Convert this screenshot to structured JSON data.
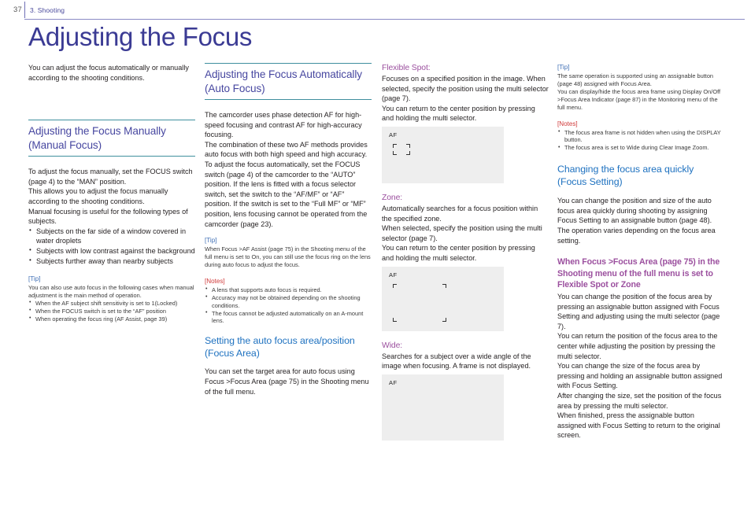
{
  "header": {
    "page_number": "37",
    "section": "3. Shooting"
  },
  "title": "Adjusting the Focus",
  "col1": {
    "intro": "You can adjust the focus automatically or manually according to the shooting conditions.",
    "heading": "Adjusting the Focus Manually (Manual Focus)",
    "para1": "To adjust the focus manually, set the FOCUS switch (page 4) to the “MAN” position.\nThis allows you to adjust the focus manually according to the shooting conditions.\nManual focusing is useful for the following types of subjects.",
    "bullets": [
      "Subjects on the far side of a window covered in water droplets",
      "Subjects with low contrast against the background",
      "Subjects further away than nearby subjects"
    ],
    "tip_title": "[Tip]",
    "tip_text": "You can also use auto focus in the following cases when manual adjustment is the main method of operation.",
    "tip_bullets": [
      "When the AF subject shift sensitivity is set to 1(Locked)",
      "When the FOCUS switch is set to the “AF” position",
      "When operating the focus ring (AF Assist, page 39)"
    ]
  },
  "col2": {
    "heading": "Adjusting the Focus Automatically (Auto Focus)",
    "para1": "The camcorder uses phase detection AF for high-speed focusing and contrast AF for high-accuracy focusing.\nThe combination of these two AF methods provides auto focus with both high speed and high accuracy.\nTo adjust the focus automatically, set the FOCUS switch (page 4) of the camcorder to the “AUTO” position. If the lens is fitted with a focus selector switch, set the switch to the “AF/MF” or “AF” position. If the switch is set to the “Full MF” or “MF” position, lens focusing cannot be operated from the camcorder (page 23).",
    "tip_title": "[Tip]",
    "tip_text": "When Focus >AF Assist (page 75) in the Shooting menu of the full menu is set to On, you can still use the focus ring on the lens during auto focus to adjust the focus.",
    "notes_title": "[Notes]",
    "notes_bullets": [
      "A lens that supports auto focus is required.",
      "Accuracy may not be obtained depending on the shooting conditions.",
      "The focus cannot be adjusted automatically on an A-mount lens."
    ],
    "subheading": "Setting the auto focus area/position (Focus Area)",
    "para2": "You can set the target area for auto focus using Focus >Focus Area (page 75) in the Shooting menu of the full menu."
  },
  "col3": {
    "flexible_spot_label": "Flexible Spot:",
    "flexible_spot_text": "Focuses on a specified position in the image. When selected, specify the position using the multi selector (page 7).\nYou can return to the center position by pressing and holding the multi selector.",
    "flexible_spot_screen_label": "AF",
    "zone_label": "Zone:",
    "zone_text": "Automatically searches for a focus position within the specified zone.\nWhen selected, specify the position using the multi selector (page 7).\nYou can return to the center position by pressing and holding the multi selector.",
    "zone_screen_label": "AF",
    "wide_label": "Wide:",
    "wide_text": "Searches for a subject over a wide angle of the image when focusing. A frame is not displayed.",
    "wide_screen_label": "AF"
  },
  "col4": {
    "tip_title": "[Tip]",
    "tip_text": "The same operation is supported using an assignable button (page 48) assigned with Focus Area.\nYou can display/hide the focus area frame using Display On/Off >Focus Area Indicator (page 87) in the Monitoring menu of the full menu.",
    "notes_title": "[Notes]",
    "notes_bullets": [
      "The focus area frame is not hidden when using the DISPLAY button.",
      "The focus area is set to Wide during Clear Image Zoom."
    ],
    "heading": "Changing the focus area quickly (Focus Setting)",
    "para1": "You can change the position and size of the auto focus area quickly during shooting by assigning Focus Setting to an assignable button (page 48).\nThe operation varies depending on the focus area setting.",
    "subheading": "When Focus >Focus Area (page 75) in the Shooting menu of the full menu is set to Flexible Spot or Zone",
    "para2": "You can change the position of the focus area by pressing an assignable button assigned with Focus Setting and adjusting using the multi selector (page 7).\nYou can return the position of the focus area to the center while adjusting the position by pressing the multi selector.\nYou can change the size of the focus area by pressing and holding an assignable button assigned with Focus Setting.\nAfter changing the size, set the position of the focus area by pressing the multi selector.\nWhen finished, press the assignable button assigned with Focus Setting to return to the original screen."
  },
  "colors": {
    "title_purple": "#3b3b94",
    "heading_indigo": "#4747a0",
    "heading_blue": "#1f72c0",
    "magenta": "#9b4f9e",
    "tip_blue": "#3f6fb5",
    "notes_red": "#d03a3a",
    "rule_teal": "#3f8f9e",
    "screen_gray": "#eeeeee"
  }
}
